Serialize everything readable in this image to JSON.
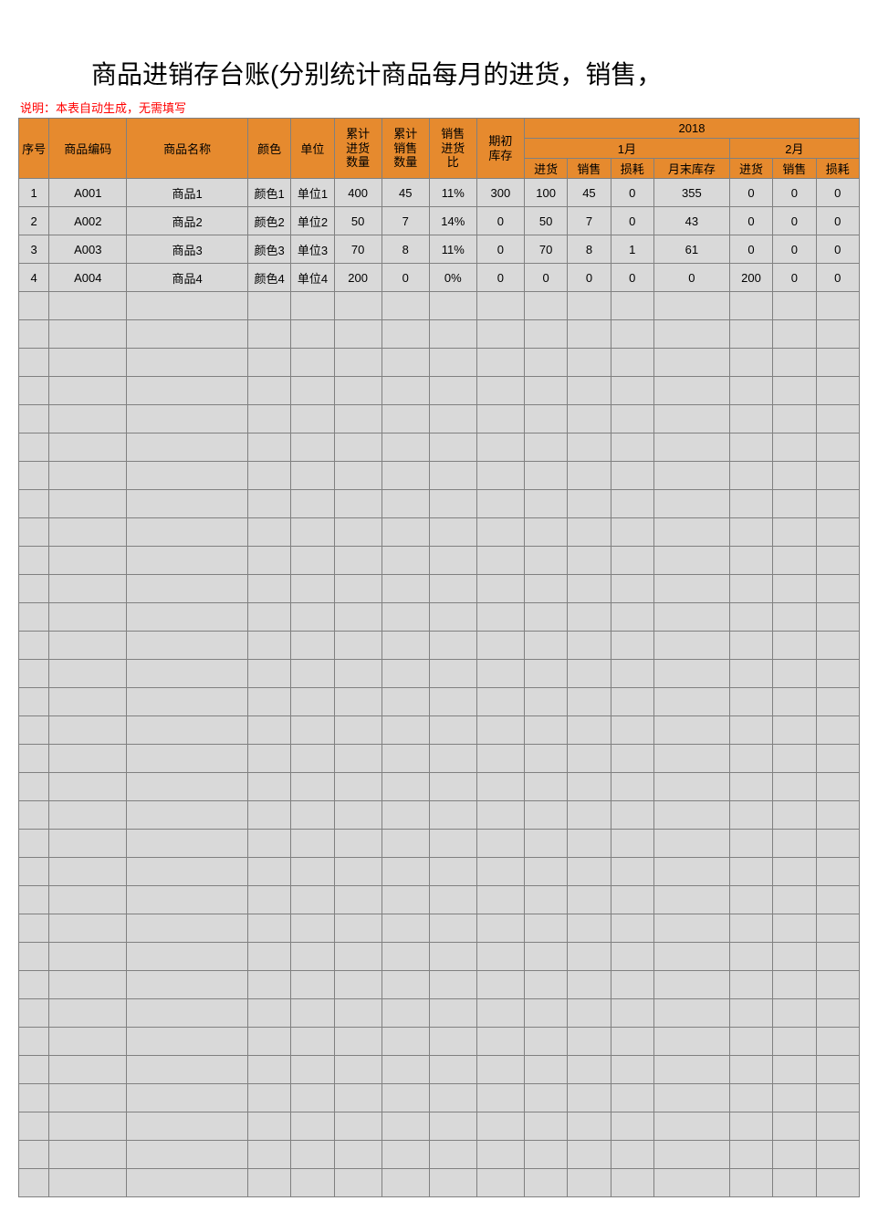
{
  "title": "商品进销存台账(分别统计商品每月的进货，销售，",
  "note": "说明：本表自动生成，无需填写",
  "headers": {
    "seq": "序号",
    "code": "商品编码",
    "name": "商品名称",
    "color": "颜色",
    "unit": "单位",
    "cumIn1": "累计",
    "cumIn2": "进货",
    "cumIn3": "数量",
    "cumOut1": "累计",
    "cumOut2": "销售",
    "cumOut3": "数量",
    "ratio1": "销售",
    "ratio2": "进货",
    "ratio3": "比",
    "begin1": "期初",
    "begin2": "库存",
    "year": "2018",
    "month1": "1月",
    "month2": "2月",
    "mIn": "进货",
    "mOut": "销售",
    "mLoss": "损耗",
    "mEnd": "月末库存"
  },
  "rows": [
    {
      "seq": "1",
      "code": "A001",
      "name": "商品1",
      "color": "颜色1",
      "unit": "单位1",
      "cumIn": "400",
      "cumOut": "45",
      "ratio": "11%",
      "begin": "300",
      "m1In": "100",
      "m1Out": "45",
      "m1Loss": "0",
      "m1End": "355",
      "m2In": "0",
      "m2Out": "0",
      "m2Loss": "0"
    },
    {
      "seq": "2",
      "code": "A002",
      "name": "商品2",
      "color": "颜色2",
      "unit": "单位2",
      "cumIn": "50",
      "cumOut": "7",
      "ratio": "14%",
      "begin": "0",
      "m1In": "50",
      "m1Out": "7",
      "m1Loss": "0",
      "m1End": "43",
      "m2In": "0",
      "m2Out": "0",
      "m2Loss": "0"
    },
    {
      "seq": "3",
      "code": "A003",
      "name": "商品3",
      "color": "颜色3",
      "unit": "单位3",
      "cumIn": "70",
      "cumOut": "8",
      "ratio": "11%",
      "begin": "0",
      "m1In": "70",
      "m1Out": "8",
      "m1Loss": "1",
      "m1End": "61",
      "m2In": "0",
      "m2Out": "0",
      "m2Loss": "0"
    },
    {
      "seq": "4",
      "code": "A004",
      "name": "商品4",
      "color": "颜色4",
      "unit": "单位4",
      "cumIn": "200",
      "cumOut": "0",
      "ratio": "0%",
      "begin": "0",
      "m1In": "0",
      "m1Out": "0",
      "m1Loss": "0",
      "m1End": "0",
      "m2In": "200",
      "m2Out": "0",
      "m2Loss": "0"
    }
  ],
  "emptyRowCount": 32
}
